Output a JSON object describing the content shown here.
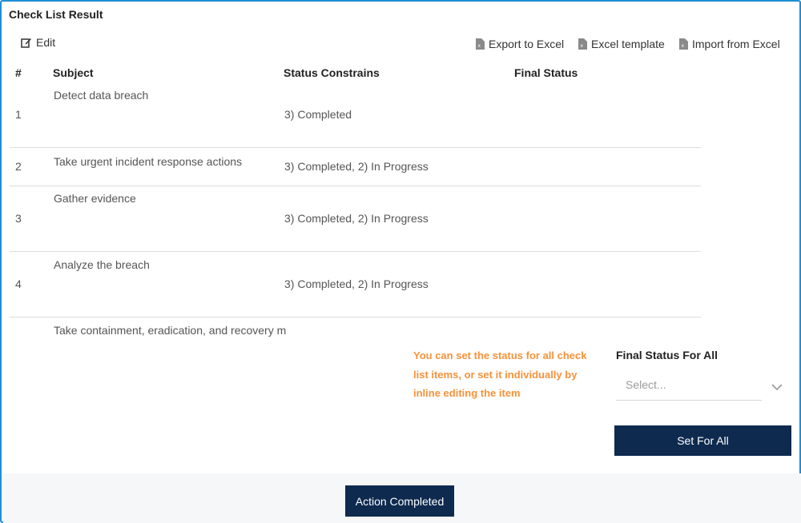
{
  "panel": {
    "title": "Check List Result"
  },
  "toolbar": {
    "edit_label": "Edit",
    "export_label": "Export to Excel",
    "template_label": "Excel template",
    "import_label": "Import from Excel"
  },
  "table": {
    "headers": {
      "num": "#",
      "subject": "Subject",
      "status": "Status Constrains",
      "final": "Final Status"
    },
    "rows": [
      {
        "num": "1",
        "subject": "Detect data breach",
        "status": "3) Completed",
        "final": ""
      },
      {
        "num": "2",
        "subject": "Take urgent incident response actions",
        "status": "3) Completed, 2) In Progress",
        "final": ""
      },
      {
        "num": "3",
        "subject": "Gather evidence",
        "status": "3) Completed, 2) In Progress",
        "final": ""
      },
      {
        "num": "4",
        "subject": "Analyze the breach",
        "status": "3) Completed, 2) In Progress",
        "final": ""
      },
      {
        "num": "",
        "subject": "Take containment, eradication, and recovery m",
        "status": "",
        "final": ""
      }
    ]
  },
  "set_all": {
    "hint": "You can set the status for all check list items, or set it individually by inline editing the item",
    "label": "Final Status For All",
    "placeholder": "Select...",
    "button": "Set For All"
  },
  "footer": {
    "action_button": "Action Completed"
  },
  "colors": {
    "accent": "#f7923a",
    "primary": "#0e2a4f",
    "border": "#1e8fd6"
  }
}
